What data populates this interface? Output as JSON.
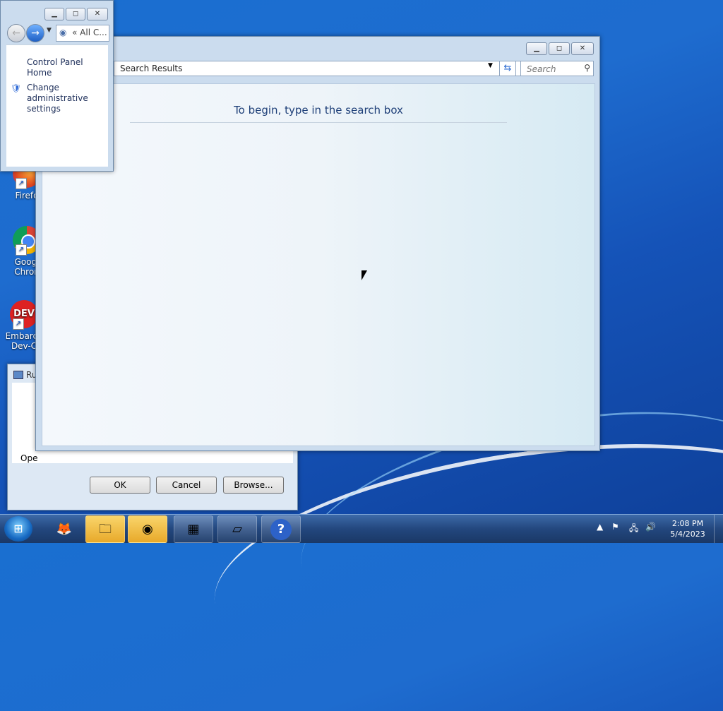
{
  "desktop": {
    "icons": [
      {
        "label": "Firefo",
        "icon": "firefox-icon"
      },
      {
        "label": "Googl Chron",
        "icon": "chrome-icon"
      },
      {
        "label": "Embarca Dev-C",
        "icon": "devcpp-icon"
      }
    ]
  },
  "search_window": {
    "address": "Search Results",
    "search_placeholder": "Search",
    "hint": "To begin, type in the search box"
  },
  "cp_window": {
    "address": "All C...",
    "links": [
      "Control Panel Home",
      "Change administrative settings"
    ]
  },
  "run_dialog": {
    "title": "Ru",
    "open_label": "Ope",
    "buttons": {
      "ok": "OK",
      "cancel": "Cancel",
      "browse": "Browse..."
    }
  },
  "taskbar": {
    "items": [
      "firefox-icon",
      "file-explorer-icon",
      "chrome-icon",
      "control-panel-icon",
      "run-icon",
      "help-icon"
    ],
    "clock_time": "2:08 PM",
    "clock_date": "5/4/2023"
  }
}
